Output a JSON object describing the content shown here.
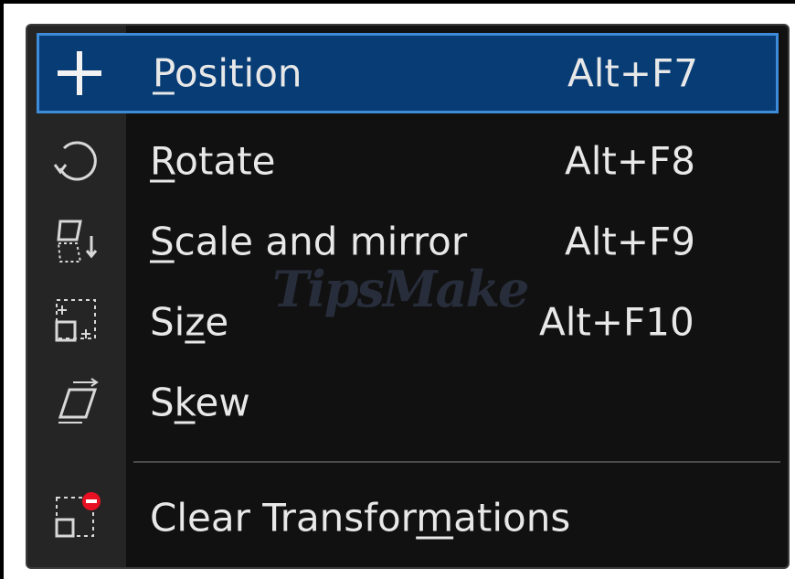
{
  "menu": {
    "items": [
      {
        "label_pre": "",
        "label_u": "P",
        "label_post": "osition",
        "shortcut": "Alt+F7",
        "icon": "move-cross-icon",
        "selected": true
      },
      {
        "label_pre": "",
        "label_u": "R",
        "label_post": "otate",
        "shortcut": "Alt+F8",
        "icon": "rotate-icon"
      },
      {
        "label_pre": "",
        "label_u": "S",
        "label_post": "cale and mirror",
        "shortcut": "Alt+F9",
        "icon": "scale-mirror-icon"
      },
      {
        "label_pre": "Si",
        "label_u": "z",
        "label_post": "e",
        "shortcut": "Alt+F10",
        "icon": "size-icon"
      },
      {
        "label_pre": "S",
        "label_u": "k",
        "label_post": "ew",
        "shortcut": "",
        "icon": "skew-icon"
      },
      {
        "label_pre": "Clear Transfor",
        "label_u": "m",
        "label_post": "ations",
        "shortcut": "",
        "icon": "clear-transformations-icon"
      }
    ]
  },
  "watermark": "TipsMake",
  "colors": {
    "menu_bg": "#111111",
    "gutter_bg": "#252525",
    "selected_bg": "#073c75",
    "selected_border": "#3d8bd9",
    "text": "#e8e8e8",
    "remove_badge": "#e81123"
  }
}
